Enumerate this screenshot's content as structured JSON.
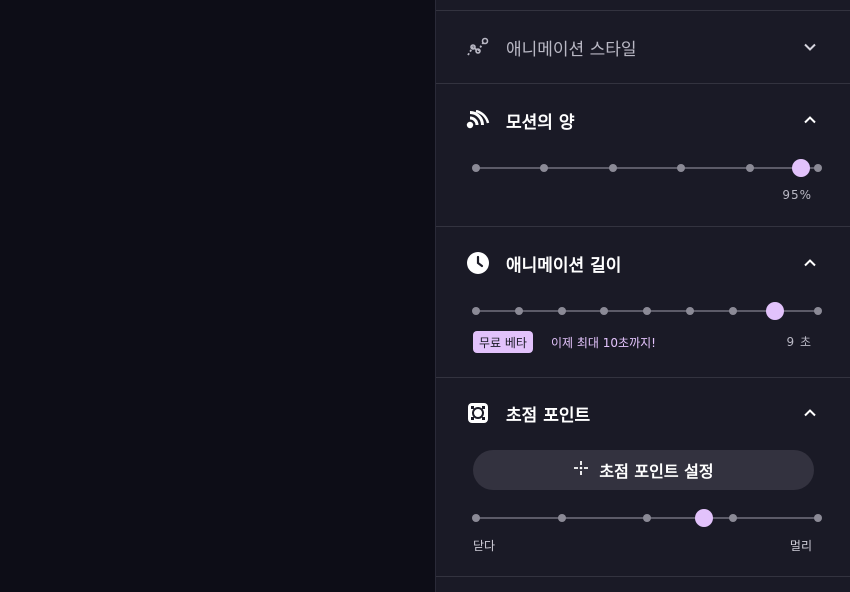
{
  "sections": {
    "animation_style": {
      "title": "애니메이션 스타일",
      "icon": "line-chart-icon"
    },
    "motion_amount": {
      "title": "모션의 양",
      "icon": "signal-icon",
      "value_label": "95%",
      "value": 0.95,
      "steps": 6
    },
    "animation_length": {
      "title": "애니메이션 길이",
      "icon": "clock-icon",
      "badge": "무료 베타",
      "promo": "이제 최대 10초까지!",
      "value_label": "9 초",
      "value": 0.875,
      "steps": 9
    },
    "focus_point": {
      "title": "초점 포인트",
      "icon": "focus-frame-icon",
      "button_label": "초점 포인트 설정",
      "button_icon": "crosshair-icon",
      "min_label": "닫다",
      "max_label": "멀리",
      "value": 0.667,
      "steps": 5
    }
  },
  "colors": {
    "accent": "#e2c2fb",
    "panel": "#1a1a26",
    "background": "#0d0d17"
  }
}
